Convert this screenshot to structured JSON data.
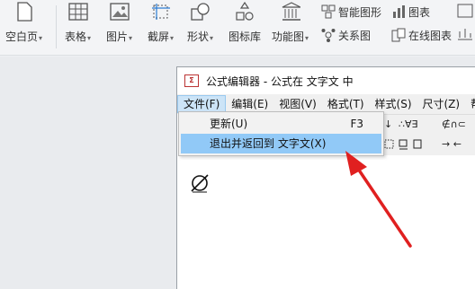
{
  "ribbon": {
    "items": [
      {
        "label": "空白页",
        "icon": "blank-page-icon"
      },
      {
        "label": "表格",
        "icon": "table-icon"
      },
      {
        "label": "图片",
        "icon": "picture-icon"
      },
      {
        "label": "截屏",
        "icon": "screenshot-icon"
      },
      {
        "label": "形状",
        "icon": "shapes-icon"
      },
      {
        "label": "图标库",
        "icon": "icon-library-icon"
      },
      {
        "label": "功能图",
        "icon": "function-chart-icon"
      }
    ],
    "small": {
      "smart_shape": "智能图形",
      "chart": "图表",
      "relation": "关系图",
      "online_chart": "在线图表"
    }
  },
  "editor": {
    "title": "公式编辑器 - 公式在 文字文 中",
    "menu": [
      "文件(F)",
      "编辑(E)",
      "视图(V)",
      "格式(T)",
      "样式(S)",
      "尺寸(Z)",
      "帮"
    ],
    "toolbar_symbols": {
      "row1_a": "↓",
      "row1_b": "∴∀∃",
      "row1_c": "∉∩⊂",
      "row2_c": "→ ←"
    }
  },
  "file_menu": {
    "items": [
      {
        "label": "更新(U)",
        "shortcut": "F3"
      },
      {
        "label": "退出并返回到 文字文(X)",
        "shortcut": ""
      }
    ],
    "highlighted_index": 1
  },
  "colors": {
    "highlight": "#91c9f7",
    "arrow": "#e02020"
  }
}
